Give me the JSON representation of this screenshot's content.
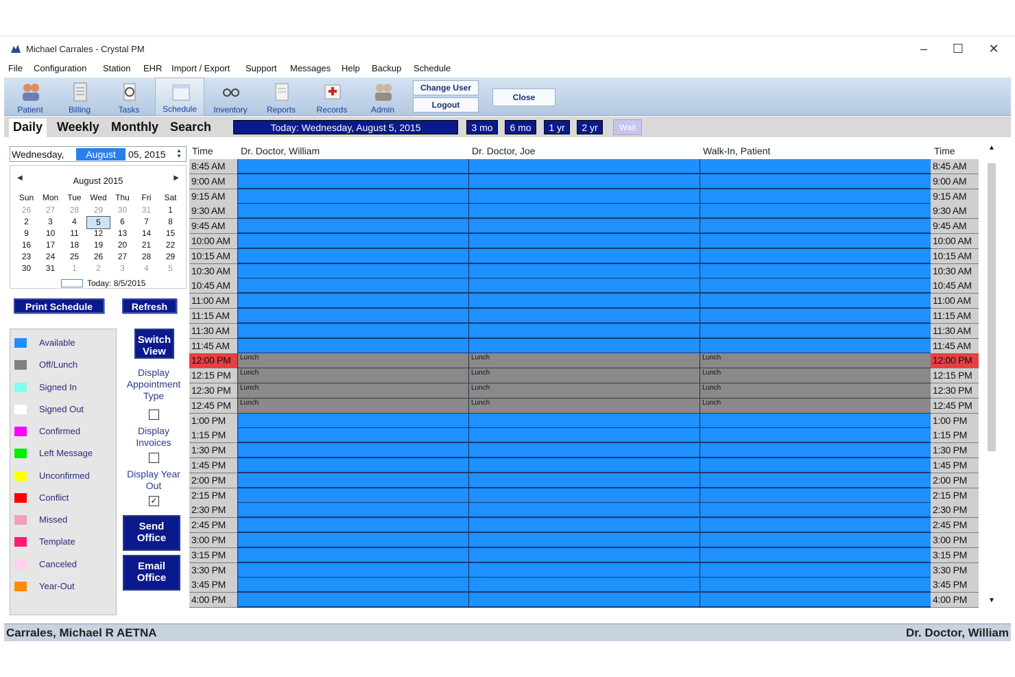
{
  "window": {
    "title": "Michael  Carrales - Crystal PM"
  },
  "menu": [
    "File",
    "Configuration",
    "Station",
    "EHR",
    "Import / Export",
    "Support",
    "Messages",
    "Help",
    "Backup",
    "Schedule"
  ],
  "toolbar": {
    "items": [
      "Patient",
      "Billing",
      "Tasks",
      "Schedule",
      "Inventory",
      "Reports",
      "Records",
      "Admin"
    ],
    "change_user": "Change User",
    "logout": "Logout",
    "close": "Close"
  },
  "views": {
    "daily": "Daily",
    "weekly": "Weekly",
    "monthly": "Monthly",
    "search": "Search"
  },
  "today_label": "Today: Wednesday, August 5, 2015",
  "ranges": [
    "3 mo",
    "6 mo",
    "1 yr",
    "2 yr"
  ],
  "wait_label": "Wait",
  "date_picker": {
    "weekday": "Wednesday,",
    "month": "August",
    "rest": "05, 2015"
  },
  "calendar": {
    "header": "August 2015",
    "dow": [
      "Sun",
      "Mon",
      "Tue",
      "Wed",
      "Thu",
      "Fri",
      "Sat"
    ],
    "weeks": [
      [
        "26",
        "27",
        "28",
        "29",
        "30",
        "31",
        "1"
      ],
      [
        "2",
        "3",
        "4",
        "5",
        "6",
        "7",
        "8"
      ],
      [
        "9",
        "10",
        "11",
        "12",
        "13",
        "14",
        "15"
      ],
      [
        "16",
        "17",
        "18",
        "19",
        "20",
        "21",
        "22"
      ],
      [
        "23",
        "24",
        "25",
        "26",
        "27",
        "28",
        "29"
      ],
      [
        "30",
        "31",
        "1",
        "2",
        "3",
        "4",
        "5"
      ]
    ],
    "today": "Today: 8/5/2015"
  },
  "buttons": {
    "print_schedule": "Print Schedule",
    "refresh": "Refresh",
    "switch_view": "Switch View",
    "send_office": "Send Office",
    "email_office": "Email Office"
  },
  "options": {
    "display_appt_type": "Display Appointment Type",
    "display_invoices": "Display Invoices",
    "display_year_out": "Display Year Out",
    "appt_type_checked": false,
    "invoices_checked": false,
    "year_out_checked": true
  },
  "legend": [
    {
      "label": "Available",
      "color": "#1e90ff"
    },
    {
      "label": "Off/Lunch",
      "color": "#808080"
    },
    {
      "label": "Signed In",
      "color": "#7fffef"
    },
    {
      "label": "Signed Out",
      "color": "#ffffff"
    },
    {
      "label": "Confirmed",
      "color": "#ff00ff"
    },
    {
      "label": "Left Message",
      "color": "#00ee00"
    },
    {
      "label": "Unconfirmed",
      "color": "#ffff00"
    },
    {
      "label": "Conflict",
      "color": "#ff0000"
    },
    {
      "label": "Missed",
      "color": "#f0a0b8"
    },
    {
      "label": "Template",
      "color": "#ff1a75"
    },
    {
      "label": "Canceled",
      "color": "#ffd0f0"
    },
    {
      "label": "Year-Out",
      "color": "#ff8c00"
    }
  ],
  "schedule": {
    "time_header": "Time",
    "columns": [
      "Dr. Doctor, William",
      "Dr. Doctor, Joe",
      "Walk-In, Patient"
    ],
    "times": [
      "8:45 AM",
      "9:00 AM",
      "9:15 AM",
      "9:30 AM",
      "9:45 AM",
      "10:00 AM",
      "10:15 AM",
      "10:30 AM",
      "10:45 AM",
      "11:00 AM",
      "11:15 AM",
      "11:30 AM",
      "11:45 AM",
      "12:00 PM",
      "12:15 PM",
      "12:30 PM",
      "12:45 PM",
      "1:00 PM",
      "1:15 PM",
      "1:30 PM",
      "1:45 PM",
      "2:00 PM",
      "2:15 PM",
      "2:30 PM",
      "2:45 PM",
      "3:00 PM",
      "3:15 PM",
      "3:30 PM",
      "3:45 PM",
      "4:00 PM"
    ],
    "highlight_time": "12:00 PM",
    "lunch_times": [
      "12:00 PM",
      "12:15 PM",
      "12:30 PM",
      "12:45 PM"
    ],
    "lunch_label": "Lunch"
  },
  "status": {
    "left": "Carrales, Michael R  AETNA",
    "right": "Dr. Doctor, William"
  }
}
